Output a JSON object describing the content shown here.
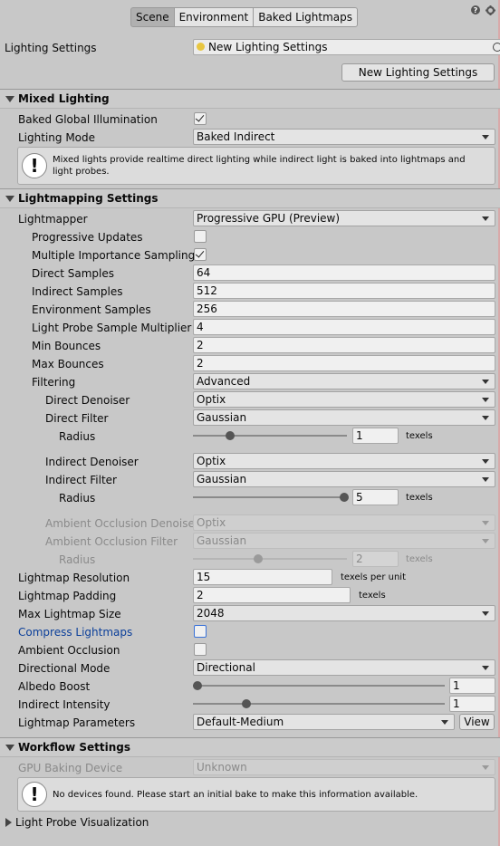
{
  "tabs": [
    "Scene",
    "Environment",
    "Baked Lightmaps"
  ],
  "top_icons": [
    "help-icon",
    "settings-icon"
  ],
  "lighting_settings": {
    "label": "Lighting Settings",
    "asset_value": "New Lighting Settings",
    "new_button": "New Lighting Settings"
  },
  "mixed_lighting": {
    "header": "Mixed Lighting",
    "baked_gi_label": "Baked Global Illumination",
    "baked_gi_checked": true,
    "lighting_mode_label": "Lighting Mode",
    "lighting_mode_value": "Baked Indirect",
    "info": "Mixed lights provide realtime direct lighting while indirect light is baked into lightmaps and light probes."
  },
  "lightmapping": {
    "header": "Lightmapping Settings",
    "lightmapper_label": "Lightmapper",
    "lightmapper_value": "Progressive GPU (Preview)",
    "progressive_updates_label": "Progressive Updates",
    "progressive_updates_checked": false,
    "mis_label": "Multiple Importance Sampling",
    "mis_checked": true,
    "direct_samples_label": "Direct Samples",
    "direct_samples": "64",
    "indirect_samples_label": "Indirect Samples",
    "indirect_samples": "512",
    "env_samples_label": "Environment Samples",
    "env_samples": "256",
    "probe_mult_label": "Light Probe Sample Multiplier",
    "probe_mult": "4",
    "min_bounces_label": "Min Bounces",
    "min_bounces": "2",
    "max_bounces_label": "Max Bounces",
    "max_bounces": "2",
    "filtering_label": "Filtering",
    "filtering_value": "Advanced",
    "direct_denoiser_label": "Direct Denoiser",
    "direct_denoiser": "Optix",
    "direct_filter_label": "Direct Filter",
    "direct_filter": "Gaussian",
    "radius_label": "Radius",
    "direct_radius": "1",
    "direct_radius_fraction": 0.22,
    "texels": "texels",
    "indirect_denoiser_label": "Indirect Denoiser",
    "indirect_denoiser": "Optix",
    "indirect_filter_label": "Indirect Filter",
    "indirect_filter": "Gaussian",
    "indirect_radius": "5",
    "indirect_radius_fraction": 0.99,
    "ao_denoiser_label": "Ambient Occlusion Denoiser",
    "ao_denoiser": "Optix",
    "ao_filter_label": "Ambient Occlusion Filter",
    "ao_filter": "Gaussian",
    "ao_radius": "2",
    "ao_radius_fraction": 0.41,
    "resolution_label": "Lightmap Resolution",
    "resolution": "15",
    "texels_per_unit": "texels per unit",
    "padding_label": "Lightmap Padding",
    "padding": "2",
    "max_size_label": "Max Lightmap Size",
    "max_size": "2048",
    "compress_label": "Compress Lightmaps",
    "compress_checked": false,
    "ao_label": "Ambient Occlusion",
    "ao_checked": false,
    "directional_label": "Directional Mode",
    "directional": "Directional",
    "albedo_label": "Albedo Boost",
    "albedo": "1",
    "albedo_fraction": 0.0,
    "indirect_intensity_label": "Indirect Intensity",
    "indirect_intensity": "1",
    "indirect_intensity_fraction": 0.2,
    "params_label": "Lightmap Parameters",
    "params": "Default-Medium",
    "view_button": "View"
  },
  "workflow": {
    "header": "Workflow Settings",
    "gpu_device_label": "GPU Baking Device",
    "gpu_device": "Unknown",
    "info": "No devices found. Please start an initial bake to make this information available."
  },
  "probe_vis": {
    "header": "Light Probe Visualization"
  }
}
